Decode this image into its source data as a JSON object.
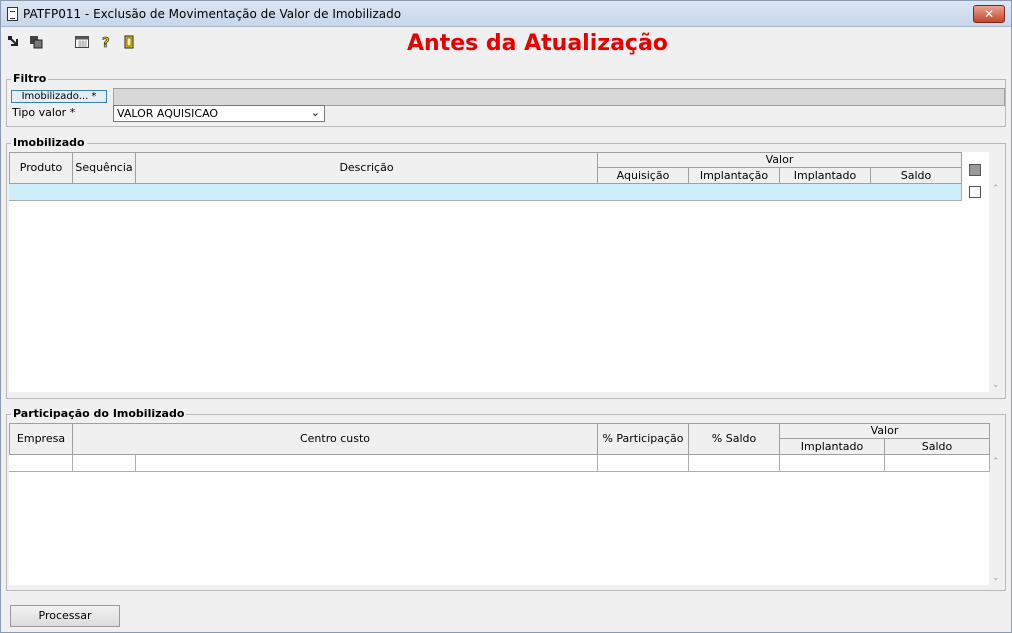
{
  "window": {
    "title": "PATFP011 - Exclusão de Movimentação de Valor de Imobilizado",
    "close_label": "✕"
  },
  "banner": "Antes da Atualização",
  "toolbar": {
    "icons": [
      "exit-icon",
      "copy-icon",
      "calendar-icon",
      "help-icon",
      "door-icon"
    ]
  },
  "filtro": {
    "title": "Filtro",
    "imobilizado_button": "Imobilizado... *",
    "imobilizado_value": "",
    "tipo_valor_label": "Tipo valor *",
    "tipo_valor_value": "VALOR AQUISICAO"
  },
  "imobilizado": {
    "title": "Imobilizado",
    "columns": {
      "produto": "Produto",
      "sequencia": "Sequência",
      "descricao": "Descrição",
      "valor": "Valor",
      "aquisicao": "Aquisição",
      "implantacao": "Implantação",
      "implantado": "Implantado",
      "saldo": "Saldo"
    }
  },
  "participacao": {
    "title": "Participação do Imobilizado",
    "columns": {
      "empresa": "Empresa",
      "centro_custo": "Centro custo",
      "participacao": "% Participação",
      "pct_saldo": "% Saldo",
      "valor": "Valor",
      "implantado": "Implantado",
      "saldo": "Saldo"
    }
  },
  "actions": {
    "processar": "Processar"
  },
  "colors": {
    "banner": "#e80000",
    "selected_row": "#cdeffb",
    "titlebar": "#c7d6ea"
  }
}
